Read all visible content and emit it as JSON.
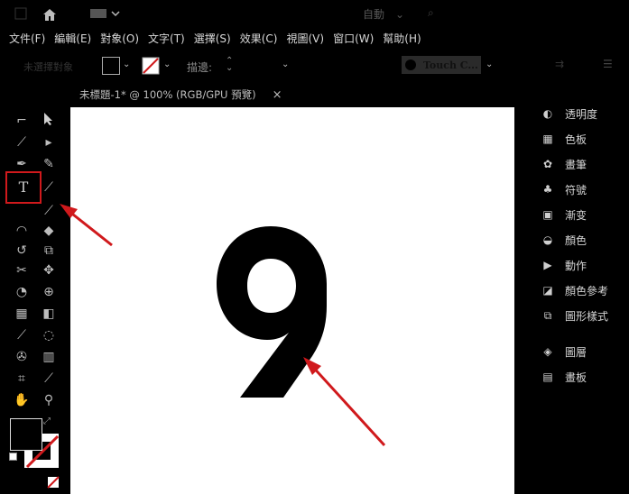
{
  "titlebar": {
    "workspace_label": "自動",
    "workspace_arrow": "⌄"
  },
  "menubar": {
    "items": [
      "文件(F)",
      "編輯(E)",
      "對象(O)",
      "文字(T)",
      "選擇(S)",
      "效果(C)",
      "視圖(V)",
      "窗口(W)",
      "幫助(H)"
    ]
  },
  "control_bar": {
    "no_selection_label": "未選擇對象",
    "stroke_label": "描邊:",
    "brush_label": "Touch C..."
  },
  "document_tab": {
    "title": "未標題-1* @ 100% (RGB/GPU 預覽)",
    "close": "×"
  },
  "canvas": {
    "artwork_text": "9"
  },
  "panels": {
    "items": [
      {
        "icon": "transparency-icon",
        "label": "透明度"
      },
      {
        "icon": "color-icon",
        "label": "色板"
      },
      {
        "icon": "brushes-icon",
        "label": "畫筆"
      },
      {
        "icon": "symbols-icon",
        "label": "符號"
      },
      {
        "icon": "gradient-icon",
        "label": "漸变"
      },
      {
        "icon": "color-panel-icon",
        "label": "顏色"
      },
      {
        "icon": "actions-icon",
        "label": "動作"
      },
      {
        "icon": "color-guide-icon",
        "label": "顏色參考"
      },
      {
        "icon": "graphic-styles-icon",
        "label": "圖形樣式"
      },
      {
        "icon": "layers-icon",
        "label": "圖層"
      },
      {
        "icon": "artboards-icon",
        "label": "畫板"
      }
    ]
  },
  "colors": {
    "annotation_red": "#d0191c",
    "highlight_box": "#d0191c",
    "canvas_bg": "#ffffff"
  }
}
